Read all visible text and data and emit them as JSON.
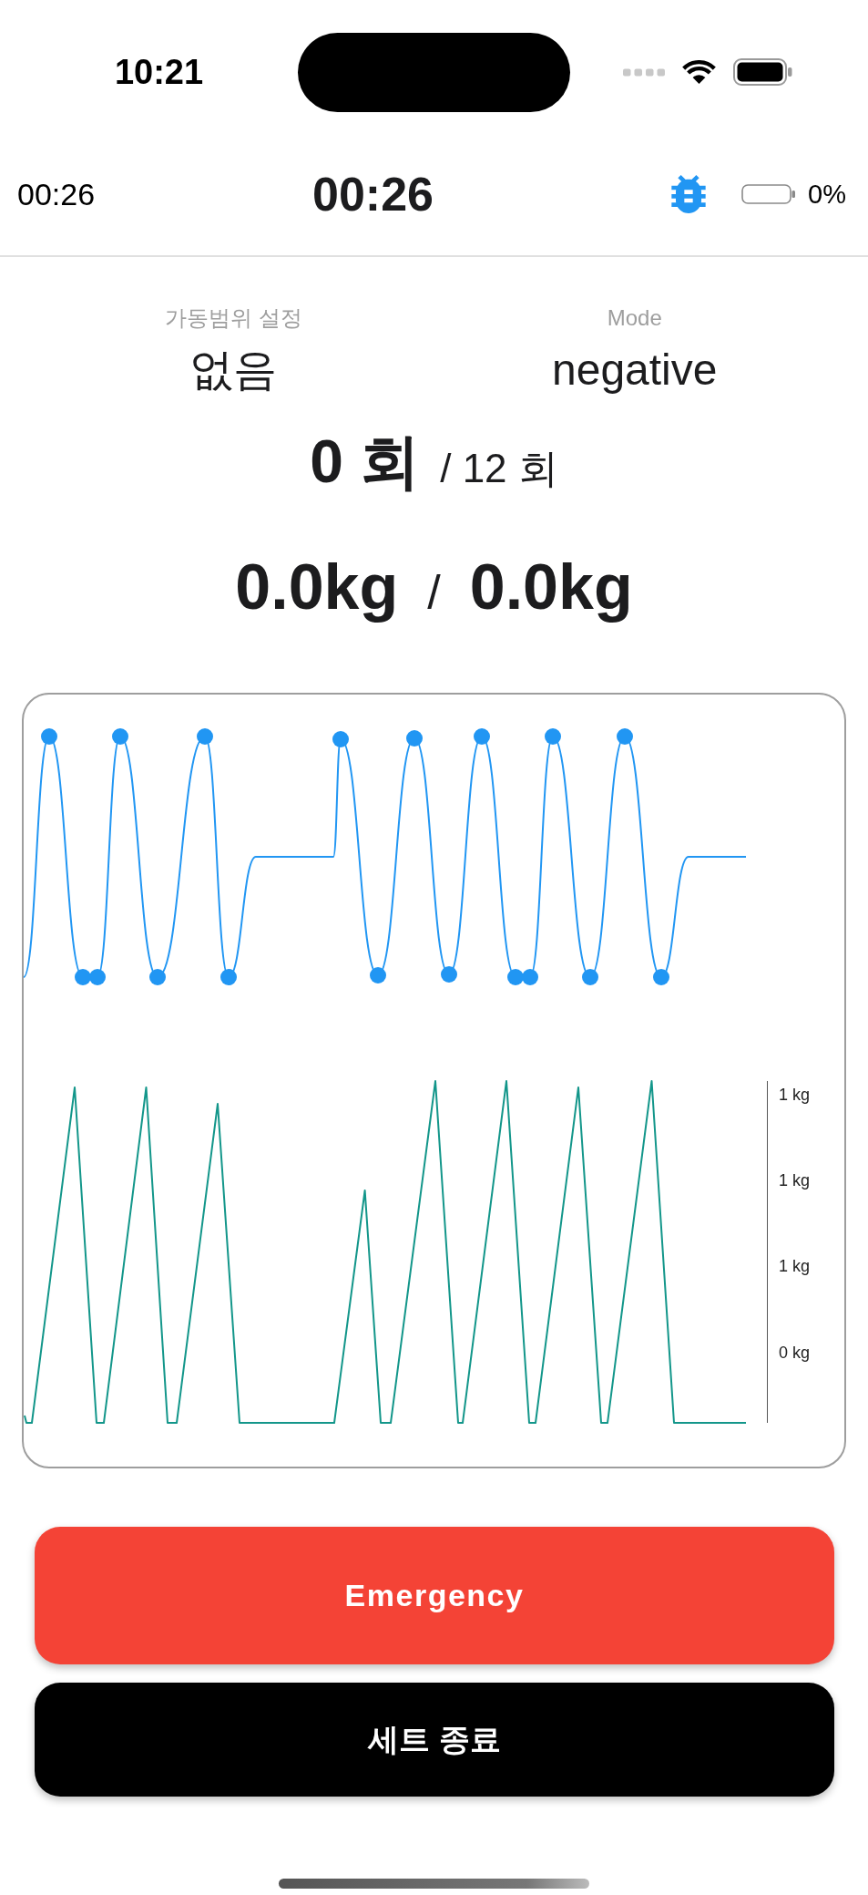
{
  "status_bar": {
    "time": "10:21"
  },
  "header": {
    "elapsed": "00:26",
    "timer": "00:26",
    "battery_percent": "0%"
  },
  "settings": [
    {
      "label": "가동범위 설정",
      "value": "없음"
    },
    {
      "label": "Mode",
      "value": "negative"
    }
  ],
  "reps": {
    "done": "0 회",
    "target": "/ 12 회"
  },
  "weight": {
    "current": "0.0kg",
    "separator": "/",
    "target": "0.0kg"
  },
  "force_chart": {
    "tick_labels": [
      "1 kg",
      "1 kg",
      "1 kg",
      "0 kg"
    ]
  },
  "buttons": [
    {
      "label": "Emergency",
      "kind": "danger"
    },
    {
      "label": "세트 종료",
      "kind": "primary"
    }
  ]
}
